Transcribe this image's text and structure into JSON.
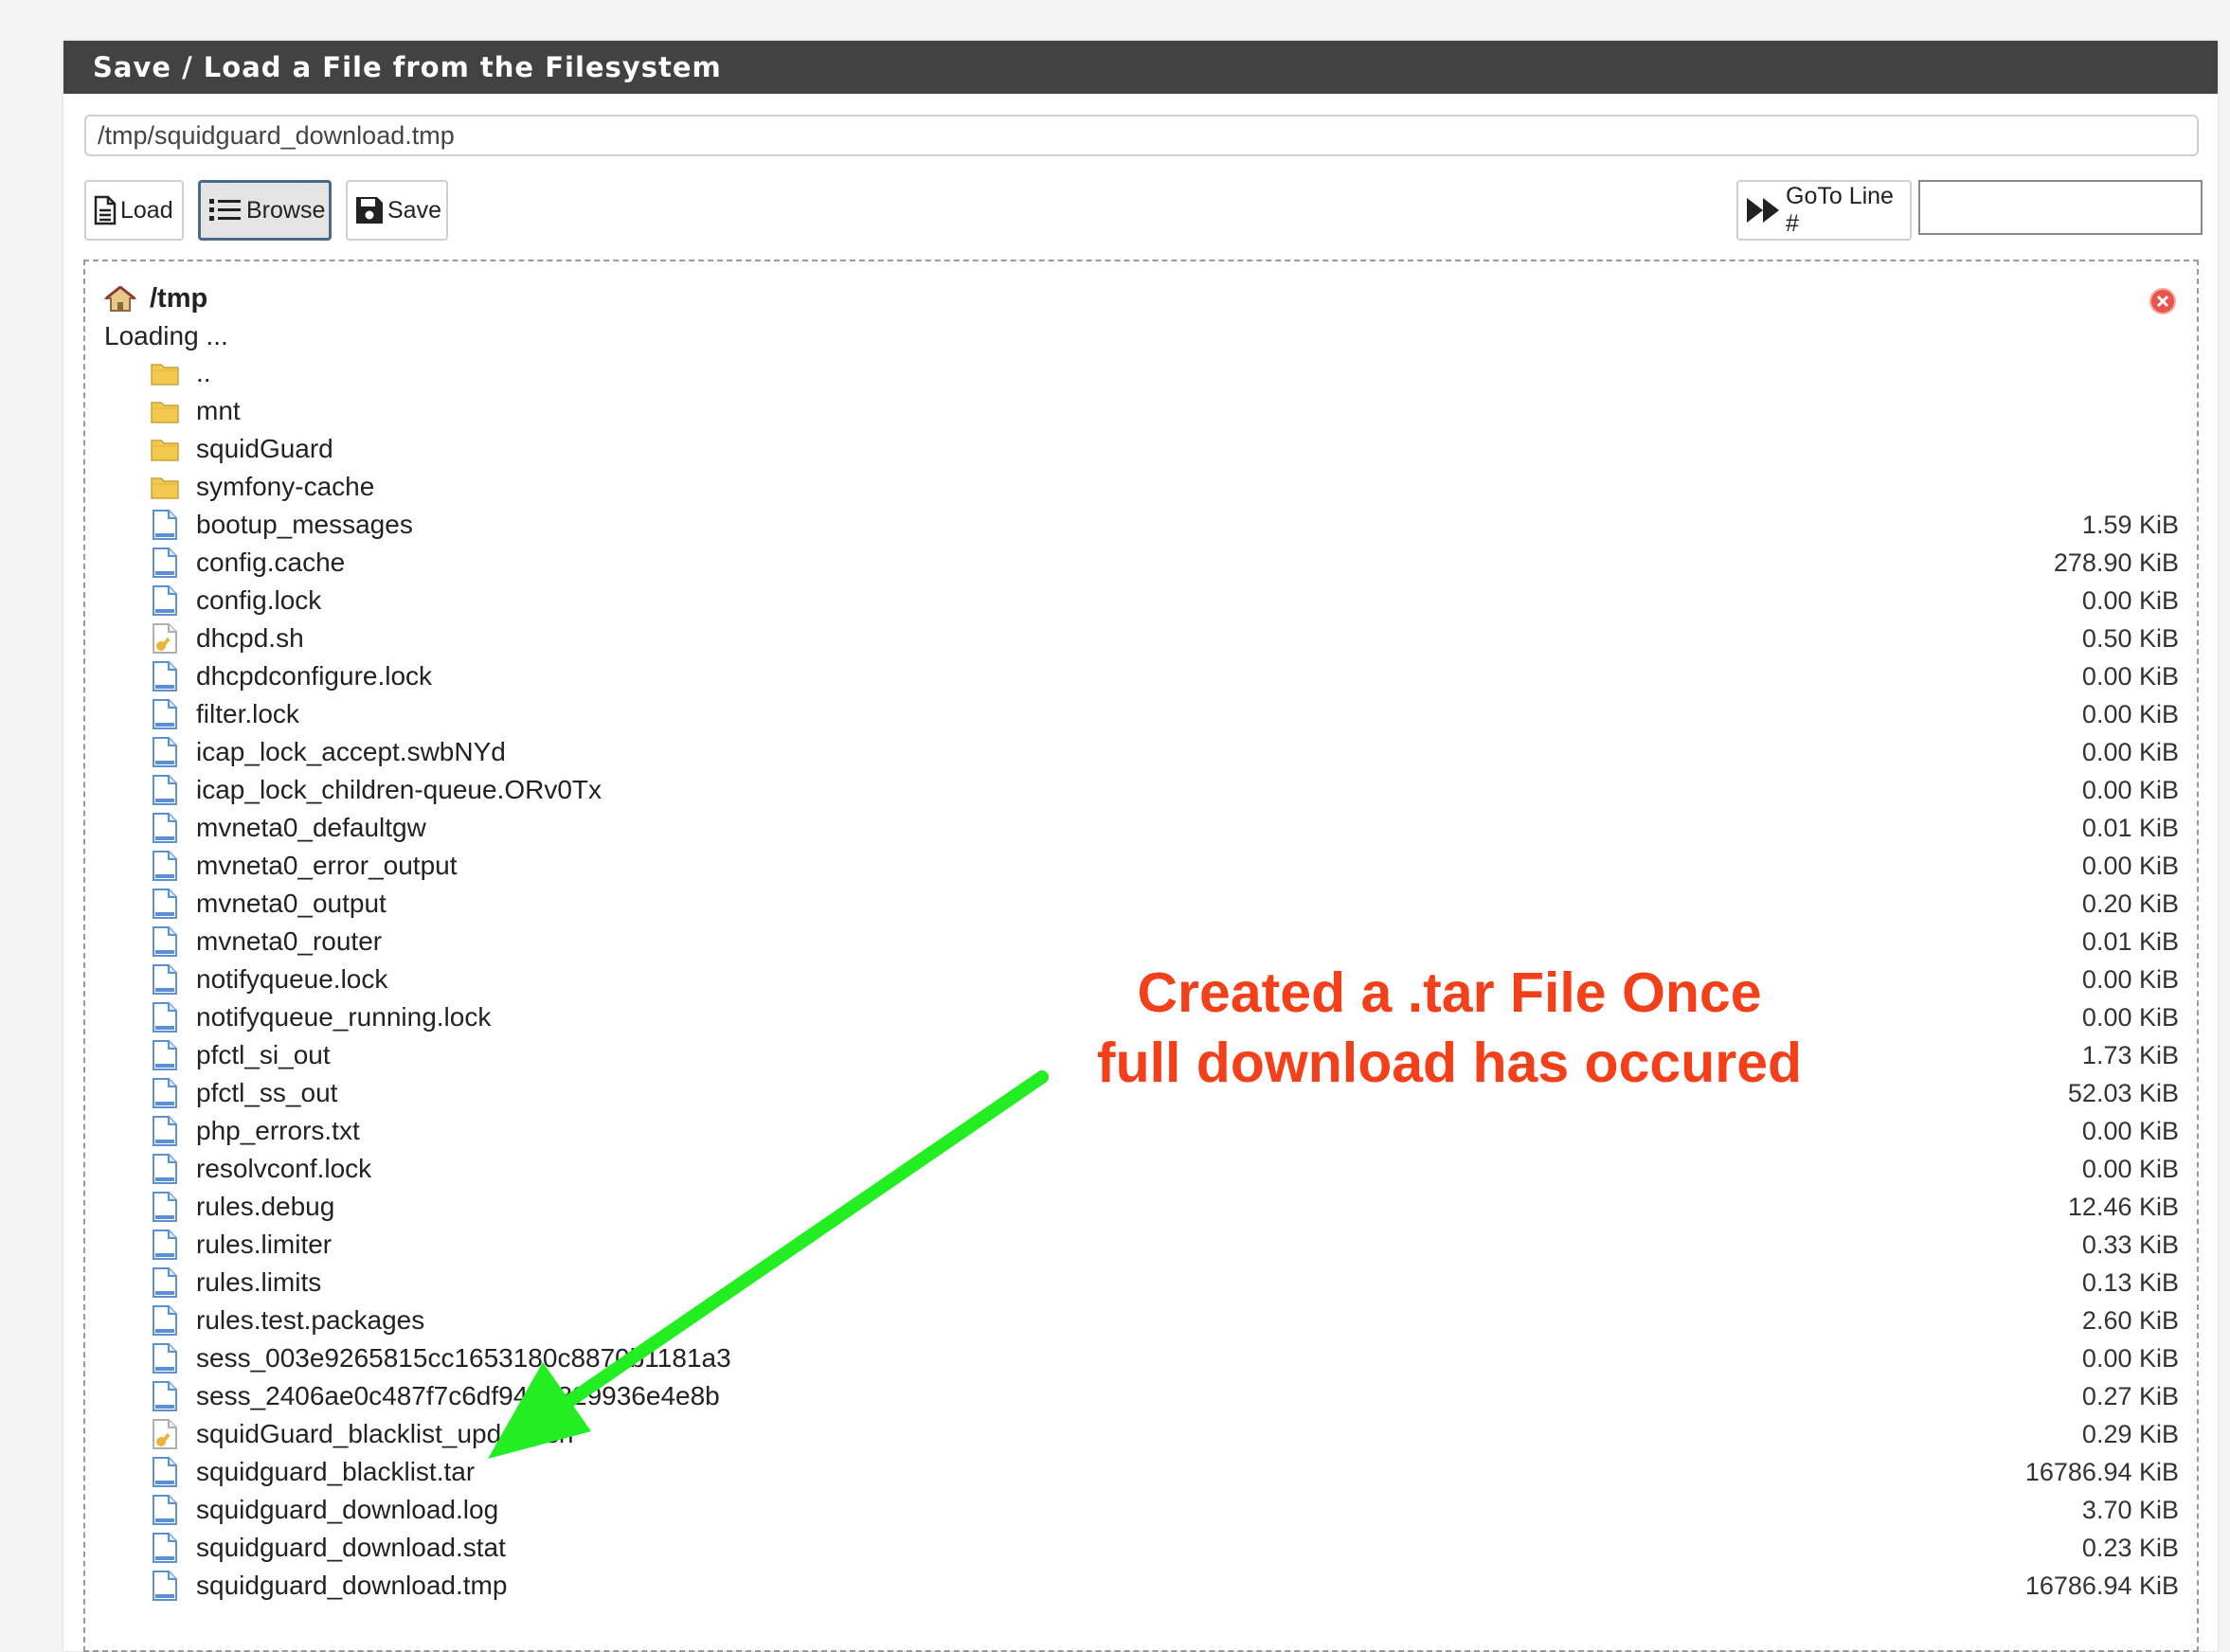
{
  "panel": {
    "title": "Save / Load a File from the Filesystem"
  },
  "path_input": {
    "value": "/tmp/squidguard_download.tmp"
  },
  "toolbar": {
    "load_label": "Load",
    "browse_label": "Browse",
    "save_label": "Save",
    "goto_label": "GoTo Line #",
    "goto_value": ""
  },
  "browser": {
    "current_dir": "/tmp",
    "status": "Loading ...",
    "entries": [
      {
        "name": "..",
        "type": "folder",
        "size": ""
      },
      {
        "name": "mnt",
        "type": "folder",
        "size": ""
      },
      {
        "name": "squidGuard",
        "type": "folder",
        "size": ""
      },
      {
        "name": "symfony-cache",
        "type": "folder",
        "size": ""
      },
      {
        "name": "bootup_messages",
        "type": "file",
        "size": "1.59 KiB"
      },
      {
        "name": "config.cache",
        "type": "file",
        "size": "278.90 KiB"
      },
      {
        "name": "config.lock",
        "type": "file",
        "size": "0.00 KiB"
      },
      {
        "name": "dhcpd.sh",
        "type": "script",
        "size": "0.50 KiB"
      },
      {
        "name": "dhcpdconfigure.lock",
        "type": "file",
        "size": "0.00 KiB"
      },
      {
        "name": "filter.lock",
        "type": "file",
        "size": "0.00 KiB"
      },
      {
        "name": "icap_lock_accept.swbNYd",
        "type": "file",
        "size": "0.00 KiB"
      },
      {
        "name": "icap_lock_children-queue.ORv0Tx",
        "type": "file",
        "size": "0.00 KiB"
      },
      {
        "name": "mvneta0_defaultgw",
        "type": "file",
        "size": "0.01 KiB"
      },
      {
        "name": "mvneta0_error_output",
        "type": "file",
        "size": "0.00 KiB"
      },
      {
        "name": "mvneta0_output",
        "type": "file",
        "size": "0.20 KiB"
      },
      {
        "name": "mvneta0_router",
        "type": "file",
        "size": "0.01 KiB"
      },
      {
        "name": "notifyqueue.lock",
        "type": "file",
        "size": "0.00 KiB"
      },
      {
        "name": "notifyqueue_running.lock",
        "type": "file",
        "size": "0.00 KiB"
      },
      {
        "name": "pfctl_si_out",
        "type": "file",
        "size": "1.73 KiB"
      },
      {
        "name": "pfctl_ss_out",
        "type": "file",
        "size": "52.03 KiB"
      },
      {
        "name": "php_errors.txt",
        "type": "file",
        "size": "0.00 KiB"
      },
      {
        "name": "resolvconf.lock",
        "type": "file",
        "size": "0.00 KiB"
      },
      {
        "name": "rules.debug",
        "type": "file",
        "size": "12.46 KiB"
      },
      {
        "name": "rules.limiter",
        "type": "file",
        "size": "0.33 KiB"
      },
      {
        "name": "rules.limits",
        "type": "file",
        "size": "0.13 KiB"
      },
      {
        "name": "rules.test.packages",
        "type": "file",
        "size": "2.60 KiB"
      },
      {
        "name": "sess_003e9265815cc1653180c8870b1181a3",
        "type": "file",
        "size": "0.00 KiB"
      },
      {
        "name": "sess_2406ae0c487f7c6df947a829936e4e8b",
        "type": "file",
        "size": "0.27 KiB"
      },
      {
        "name": "squidGuard_blacklist_update.sh",
        "type": "script",
        "size": "0.29 KiB"
      },
      {
        "name": "squidguard_blacklist.tar",
        "type": "file",
        "size": "16786.94 KiB"
      },
      {
        "name": "squidguard_download.log",
        "type": "file",
        "size": "3.70 KiB"
      },
      {
        "name": "squidguard_download.stat",
        "type": "file",
        "size": "0.23 KiB"
      },
      {
        "name": "squidguard_download.tmp",
        "type": "file",
        "size": "16786.94 KiB"
      }
    ]
  },
  "annotation": {
    "line1": "Created a .tar File Once",
    "line2": "full download has occured",
    "text_color": "#f4401a",
    "arrow_color": "#22ee22"
  },
  "colors": {
    "header_bg": "#424242",
    "folder": "#f2c94c",
    "file": "#5b8fd6",
    "close": "#e8544a"
  }
}
